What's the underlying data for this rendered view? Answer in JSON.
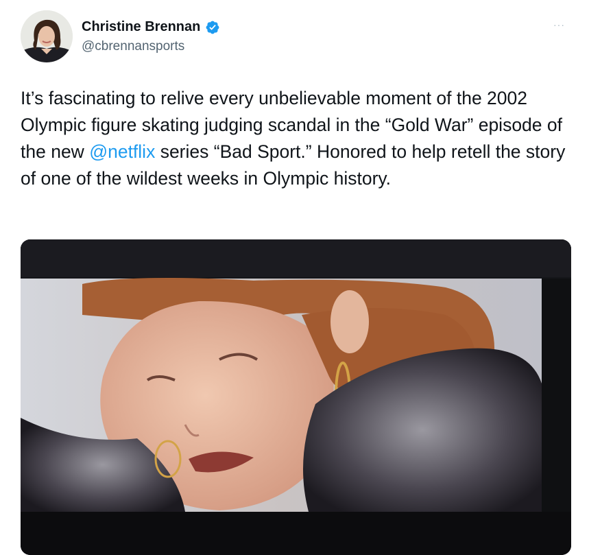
{
  "author": {
    "name": "Christine Brennan",
    "handle": "@cbrennansports",
    "avatar_icon": "profile-photo",
    "verified_icon": "verified-badge-icon",
    "verified_color": "#1d9bf0"
  },
  "more_label": "···",
  "tweet": {
    "text_part1": "It’s fascinating to relive every unbelievable moment of the 2002 Olympic figure skating judging scandal in the “Gold War” episode of the new ",
    "mention": "@netflix",
    "text_part2": " series “Bad Sport.” Honored to help retell the story of one of the wildest weeks in Olympic history."
  },
  "colors": {
    "text": "#0f1419",
    "secondary": "#536471",
    "link": "#1d9bf0"
  }
}
